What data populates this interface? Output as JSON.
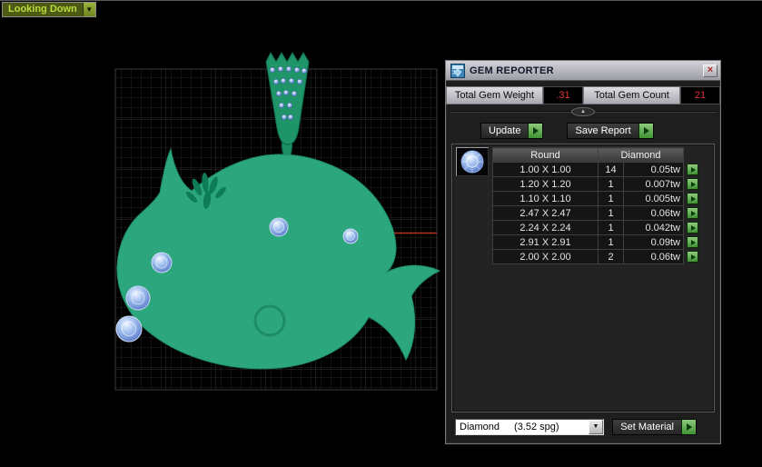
{
  "viewport": {
    "label": "Looking Down"
  },
  "icons": {
    "collapse": "▲",
    "dropdown": "▼",
    "close": "×"
  },
  "panel": {
    "title": "GEM REPORTER",
    "totals": {
      "weight_label": "Total Gem Weight",
      "weight_value": ".31",
      "count_label": "Total Gem Count",
      "count_value": "21"
    },
    "actions": {
      "update": "Update",
      "save_report": "Save Report"
    },
    "table": {
      "shape_header": "Round",
      "material_header": "Diamond",
      "rows": [
        {
          "size": "1.00 X 1.00",
          "count": "14",
          "weight": "0.05tw"
        },
        {
          "size": "1.20 X 1.20",
          "count": "1",
          "weight": "0.007tw"
        },
        {
          "size": "1.10 X 1.10",
          "count": "1",
          "weight": "0.005tw"
        },
        {
          "size": "2.47 X 2.47",
          "count": "1",
          "weight": "0.06tw"
        },
        {
          "size": "2.24 X 2.24",
          "count": "1",
          "weight": "0.042tw"
        },
        {
          "size": "2.91 X 2.91",
          "count": "1",
          "weight": "0.09tw"
        },
        {
          "size": "2.00 X 2.00",
          "count": "2",
          "weight": "0.06tw"
        }
      ]
    },
    "material": {
      "dropdown_name": "Diamond",
      "dropdown_spg": "(3.52 spg)",
      "set_material": "Set Material"
    }
  },
  "colors": {
    "accent_green": "#3e9232",
    "value_red": "#e03434",
    "pendant_teal": "#2ca77d"
  }
}
